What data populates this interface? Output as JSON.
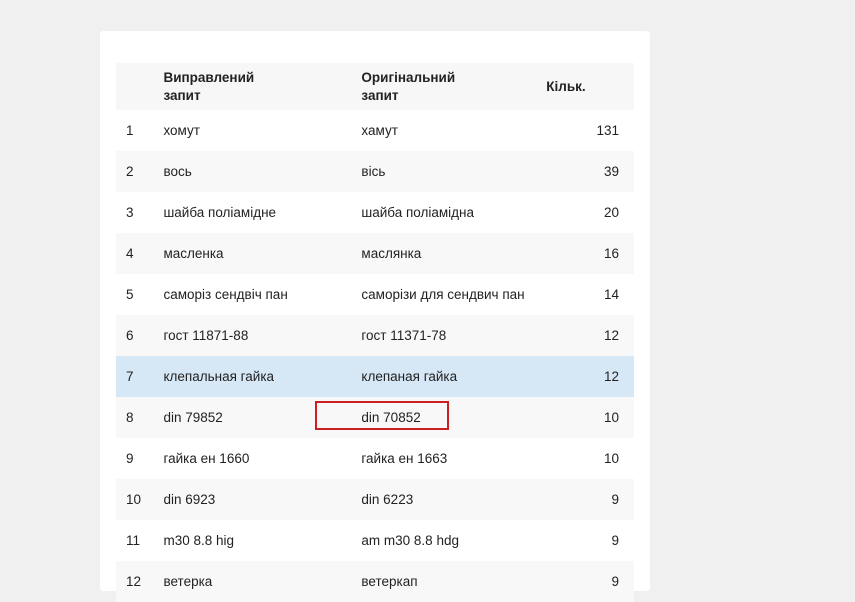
{
  "table": {
    "headers": {
      "corrected": "Виправлений запит",
      "original": "Оригінальний запит",
      "count": "Кільк."
    },
    "rows": [
      {
        "num": "1",
        "corrected": "хомут",
        "original": "хамут",
        "count": "131"
      },
      {
        "num": "2",
        "corrected": "вось",
        "original": "вісь",
        "count": "39"
      },
      {
        "num": "3",
        "corrected": "шайба поліамідне",
        "original": "шайба поліамідна",
        "count": "20"
      },
      {
        "num": "4",
        "corrected": "масленка",
        "original": "маслянка",
        "count": "16"
      },
      {
        "num": "5",
        "corrected": "саморіз сендвіч пан",
        "original": "саморізи для сендвич пан",
        "count": "14"
      },
      {
        "num": "6",
        "corrected": "гост 11871-88",
        "original": "гост 11371-78",
        "count": "12"
      },
      {
        "num": "7",
        "corrected": "клепальная гайка",
        "original": "клепаная гайка",
        "count": "12",
        "selected": true
      },
      {
        "num": "8",
        "corrected": "din 79852",
        "original": "din 70852",
        "count": "10",
        "highlighted": true
      },
      {
        "num": "9",
        "corrected": "гайка ен 1660",
        "original": "гайка ен 1663",
        "count": "10"
      },
      {
        "num": "10",
        "corrected": "din 6923",
        "original": "din 6223",
        "count": "9"
      },
      {
        "num": "11",
        "corrected": "m30 8.8 hig",
        "original": "am m30 8.8 hdg",
        "count": "9"
      },
      {
        "num": "12",
        "corrected": "ветерка",
        "original": "ветеркап",
        "count": "9"
      }
    ]
  },
  "colors": {
    "selected_row": "#d6e7f6",
    "highlight_border": "#cc1f1f"
  }
}
